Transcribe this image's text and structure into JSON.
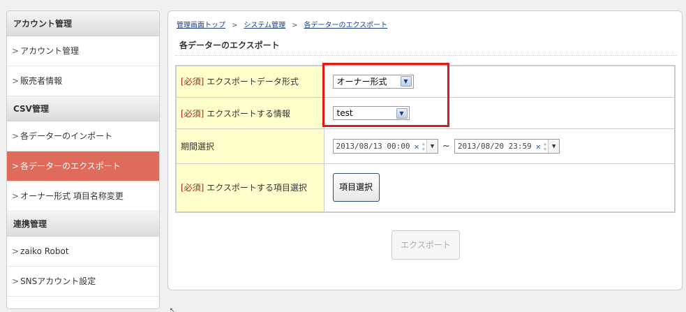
{
  "sidebar": {
    "sections": [
      {
        "title": "アカウント管理",
        "items": [
          {
            "label": "アカウント管理"
          },
          {
            "label": "販売者情報"
          }
        ]
      },
      {
        "title": "CSV管理",
        "items": [
          {
            "label": "各データーのインポート"
          },
          {
            "label": "各データーのエクスポート",
            "active": true
          },
          {
            "label": "オーナー形式 項目名称変更"
          }
        ]
      },
      {
        "title": "連携管理",
        "items": [
          {
            "label": "zaiko Robot"
          },
          {
            "label": "SNSアカウント設定"
          }
        ]
      }
    ],
    "chevron": ">"
  },
  "breadcrumb": {
    "items": [
      "管理画面トップ",
      "システム管理",
      "各データーのエクスポート"
    ],
    "separator": ">"
  },
  "page_title": "各データーのエクスポート",
  "form": {
    "required_tag": "[必須]",
    "rows": {
      "format": {
        "label": "エクスポートデータ形式",
        "value": "オーナー形式"
      },
      "info": {
        "label": "エクスポートする情報",
        "value": "test"
      },
      "period": {
        "label": "期間選択",
        "from": "2013/08/13 00:00",
        "to": "2013/08/20 23:59",
        "separator": "~"
      },
      "items": {
        "label": "エクスポートする項目選択",
        "button": "項目選択"
      }
    }
  },
  "export_button": "エクスポート",
  "colors": {
    "active_item": "#de6b5c",
    "required": "#b22222",
    "highlight_box": "#e21818",
    "label_bg": "#ffffcc"
  }
}
